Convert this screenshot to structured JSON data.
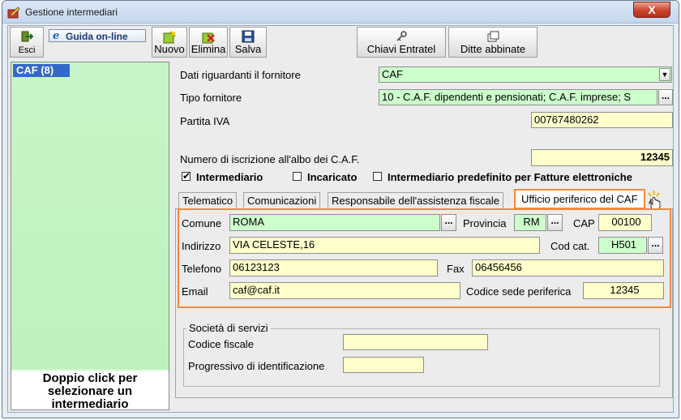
{
  "window": {
    "title": "Gestione intermediari",
    "close_glyph": "X"
  },
  "toolbar": {
    "esci": "Esci",
    "guida_icon": "e",
    "guida": "Guida on-line",
    "nuovo": "Nuovo",
    "elimina": "Elimina",
    "salva": "Salva",
    "chiavi": "Chiavi Entratel",
    "ditte": "Ditte abbinate"
  },
  "sidebar": {
    "selected_item": "CAF (8)",
    "hint": "Doppio click per selezionare un intermediario"
  },
  "form": {
    "dati_label": "Dati riguardanti il fornitore",
    "dati_value": "CAF",
    "tipo_label": "Tipo fornitore",
    "tipo_value": "10 - C.A.F. dipendenti e pensionati; C.A.F. imprese; S",
    "piva_label": "Partita IVA",
    "piva_value": "00767480262",
    "numero_label": "Numero di iscrizione all'albo dei C.A.F.",
    "numero_value": "12345",
    "chk_intermediario": "Intermediario",
    "chk_incaricato": "Incaricato",
    "chk_predefinito": "Intermediario predefinito per Fatture elettroniche",
    "dots": "..."
  },
  "tabs": {
    "telematico": "Telematico",
    "comunicazioni": "Comunicazioni",
    "responsabile": "Responsabile dell'assistenza fiscale",
    "ufficio": "Ufficio periferico del CAF"
  },
  "ufficio": {
    "comune_label": "Comune",
    "comune_value": "ROMA",
    "provincia_label": "Provincia",
    "provincia_value": "RM",
    "cap_label": "CAP",
    "cap_value": "00100",
    "indirizzo_label": "Indirizzo",
    "indirizzo_value": "VIA CELESTE,16",
    "codcat_label": "Cod cat.",
    "codcat_value": "H501",
    "telefono_label": "Telefono",
    "telefono_value": "06123123",
    "fax_label": "Fax",
    "fax_value": "06456456",
    "email_label": "Email",
    "email_value": "caf@caf.it",
    "sede_label": "Codice sede periferica",
    "sede_value": "12345"
  },
  "societa": {
    "title": "Società di servizi",
    "cf_label": "Codice fiscale",
    "cf_value": "",
    "prog_label": "Progressivo di identificazione",
    "prog_value": ""
  },
  "colors": {
    "selection": "#3468c9",
    "highlight": "#f08a3c",
    "yellow_field": "#ffffcc",
    "green_field": "#ccffcc"
  }
}
